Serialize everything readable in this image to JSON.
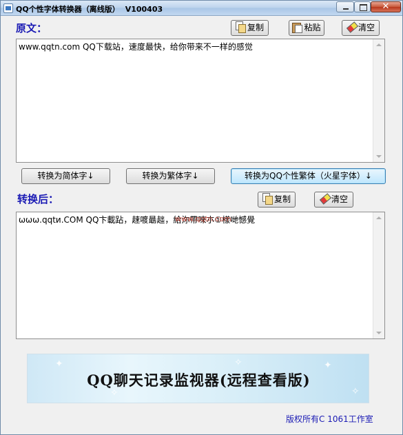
{
  "window": {
    "title": "QQ个性字体转换器（离线版）",
    "version": "V100403",
    "close_glyph": "✕"
  },
  "original": {
    "label": "原文：",
    "copy_label": "复制",
    "paste_label": "粘贴",
    "clear_label": "清空",
    "text": "www.qqtn.com QQ下载站，速度最快，给你带来不一样的感觉"
  },
  "actions": {
    "simplified_label": "转换为简体字↓",
    "traditional_label": "转换为繁体字↓",
    "qq_label": "转换为QQ个性繁体（火星字体）↓"
  },
  "converted": {
    "label": "转换后：",
    "copy_label": "复制",
    "clear_label": "清空",
    "text": "ωωω.qqtи.COM QQ卞載跕，趚喥朂趉，給沵帶唻朩①樣哋憾覺",
    "watermark": "www.qqtn.com"
  },
  "banner": {
    "text": "QQ聊天记录监视器(远程查看版)"
  },
  "footer": {
    "text": "版权所有C 1061工作室"
  }
}
